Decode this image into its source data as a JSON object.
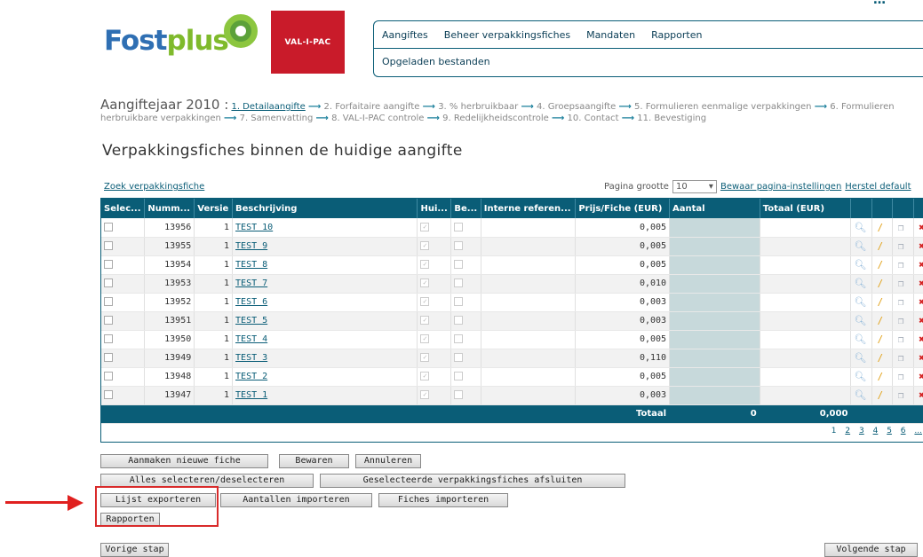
{
  "header": {
    "logo_fost": "Fost",
    "logo_plus": "plus",
    "logo_valipac": "VAL-I-PAC",
    "nav": [
      "Aangiftes",
      "Beheer verpakkingsfiches",
      "Mandaten",
      "Rapporten"
    ],
    "subnav": "Opgeladen bestanden"
  },
  "breadcrumb": {
    "year_label": "Aangiftejaar 2010 :",
    "steps": [
      "1. Detailaangifte",
      "2. Forfaitaire aangifte",
      "3. % herbruikbaar",
      "4. Groepsaangifte",
      "5. Formulieren eenmalige verpakkingen",
      "6. Formulieren herbruikbare verpakkingen",
      "7. Samenvatting",
      "8. VAL-I-PAC controle",
      "9. Redelijkheidscontrole",
      "10. Contact",
      "11. Bevestiging"
    ]
  },
  "page_title": "Verpakkingsfiches binnen de huidige aangifte",
  "toolbar": {
    "search_link": "Zoek verpakkingsfiche",
    "page_size_label": "Pagina grootte",
    "page_size_value": "10",
    "save_settings": "Bewaar pagina-instellingen",
    "reset_default": "Herstel default"
  },
  "grid": {
    "columns": [
      "Selec...",
      "Numm...",
      "Versie",
      "Beschrijving",
      "Hui...",
      "Be...",
      "Interne referen...",
      "Prijs/Fiche (EUR)",
      "Aantal",
      "Totaal (EUR)"
    ],
    "rows": [
      {
        "number": "13956",
        "version": "1",
        "desc": "TEST 10",
        "price": "0,005"
      },
      {
        "number": "13955",
        "version": "1",
        "desc": "TEST 9",
        "price": "0,005"
      },
      {
        "number": "13954",
        "version": "1",
        "desc": "TEST 8",
        "price": "0,005"
      },
      {
        "number": "13953",
        "version": "1",
        "desc": "TEST 7",
        "price": "0,010"
      },
      {
        "number": "13952",
        "version": "1",
        "desc": "TEST 6",
        "price": "0,003"
      },
      {
        "number": "13951",
        "version": "1",
        "desc": "TEST 5",
        "price": "0,003"
      },
      {
        "number": "13950",
        "version": "1",
        "desc": "TEST 4",
        "price": "0,005"
      },
      {
        "number": "13949",
        "version": "1",
        "desc": "TEST 3",
        "price": "0,110"
      },
      {
        "number": "13948",
        "version": "1",
        "desc": "TEST 2",
        "price": "0,005"
      },
      {
        "number": "13947",
        "version": "1",
        "desc": "TEST 1",
        "price": "0,003"
      }
    ],
    "total_label": "Totaal",
    "total_aantal": "0",
    "total_amount": "0,000",
    "pages": [
      "1",
      "2",
      "3",
      "4",
      "5",
      "6",
      "..."
    ]
  },
  "buttons": {
    "new_fiche": "Aanmaken nieuwe fiche",
    "save": "Bewaren",
    "cancel": "Annuleren",
    "select_all": "Alles selecteren/deselecteren",
    "close_selected": "Geselecteerde verpakkingsfiches afsluiten",
    "export_list": "Lijst exporteren",
    "import_amounts": "Aantallen importeren",
    "import_fiches": "Fiches importeren",
    "reports": "Rapporten",
    "prev_step": "Vorige stap",
    "next_step": "Volgende stap"
  },
  "colors": {
    "primary": "#0a5d77",
    "annotation": "#e0201f"
  }
}
